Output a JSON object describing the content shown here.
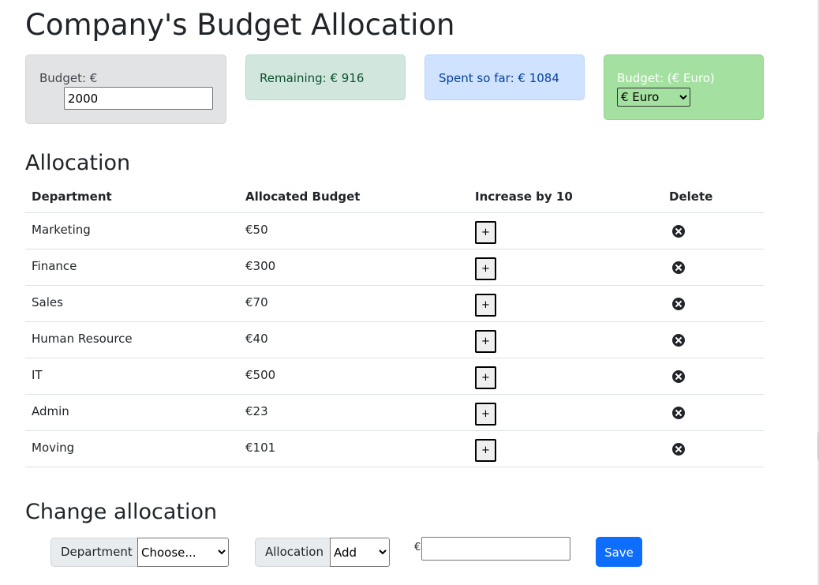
{
  "title": "Company's Budget Allocation",
  "cards": {
    "budget_label": "Budget: €",
    "budget_value": "2000",
    "remaining": "Remaining: € 916",
    "spent": "Spent so far: € 1084",
    "currency_label": "Budget: (€ Euro)",
    "currency_selected": "€ Euro"
  },
  "allocation": {
    "heading": "Allocation",
    "columns": [
      "Department",
      "Allocated Budget",
      "Increase by 10",
      "Delete"
    ],
    "rows": [
      {
        "department": "Marketing",
        "budget": "€50",
        "increase": "+"
      },
      {
        "department": "Finance",
        "budget": "€300",
        "increase": "+"
      },
      {
        "department": "Sales",
        "budget": "€70",
        "increase": "+"
      },
      {
        "department": "Human Resource",
        "budget": "€40",
        "increase": "+"
      },
      {
        "department": "IT",
        "budget": "€500",
        "increase": "+"
      },
      {
        "department": "Admin",
        "budget": "€23",
        "increase": "+"
      },
      {
        "department": "Moving",
        "budget": "€101",
        "increase": "+"
      }
    ]
  },
  "change": {
    "heading": "Change allocation",
    "department_label": "Department",
    "department_selected": "Choose...",
    "allocation_label": "Allocation",
    "allocation_selected": "Add",
    "currency_prefix": "€",
    "amount_value": "",
    "save_label": "Save"
  },
  "colors": {
    "save_button": "#0d6efd",
    "remaining_bg": "#d1e7dd",
    "spent_bg": "#cfe2ff",
    "currency_bg": "#a4e1a0",
    "budget_bg": "#e2e3e5"
  }
}
